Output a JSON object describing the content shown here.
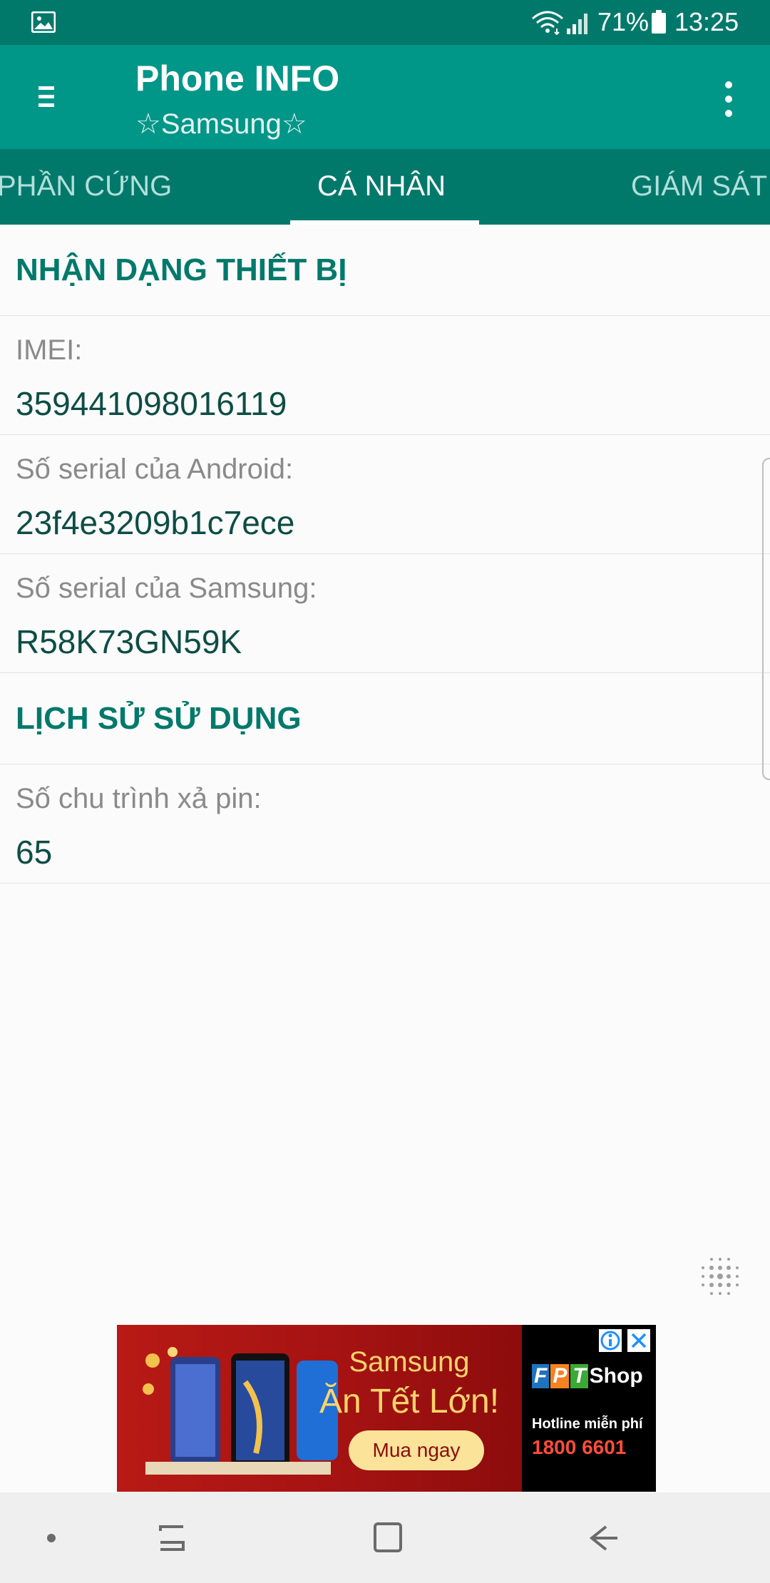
{
  "status_bar": {
    "battery_percent": "71%",
    "time": "13:25",
    "icons": [
      "gallery-icon",
      "wifi-icon",
      "signal-icon",
      "battery-icon"
    ]
  },
  "app_bar": {
    "title": "Phone INFO",
    "subtitle": "☆Samsung☆",
    "menu_icon": "hamburger-menu-icon",
    "overflow_icon": "more-vertical-icon"
  },
  "tabs": {
    "items": [
      {
        "label": "PHẦN CỨNG"
      },
      {
        "label": "CÁ NHÂN"
      },
      {
        "label": "GIÁM SÁT"
      }
    ],
    "active_index": 1
  },
  "sections": [
    {
      "header": "NHẬN DẠNG THIẾT BỊ",
      "rows": [
        {
          "label": "IMEI:",
          "value": "359441098016119"
        },
        {
          "label": "Số serial của Android:",
          "value": "23f4e3209b1c7ece"
        },
        {
          "label": "Số serial của Samsung:",
          "value": "R58K73GN59K"
        }
      ]
    },
    {
      "header": "LỊCH SỬ SỬ DỤNG",
      "rows": [
        {
          "label": "Số chu trình xả pin:",
          "value": "65"
        }
      ]
    }
  ],
  "ad": {
    "headline": "Samsung",
    "headline2": "Ăn Tết Lớn!",
    "cta": "Mua ngay",
    "brand": "Shop",
    "brand_letters": [
      "F",
      "P",
      "T"
    ],
    "hotline_label": "Hotline miễn phí",
    "hotline_number": "1800 6601"
  },
  "colors": {
    "status_bar": "#00796b",
    "app_bar": "#009688",
    "tab_bar": "#00796b",
    "accent_text": "#00796b",
    "value_text": "#0d4d45"
  }
}
